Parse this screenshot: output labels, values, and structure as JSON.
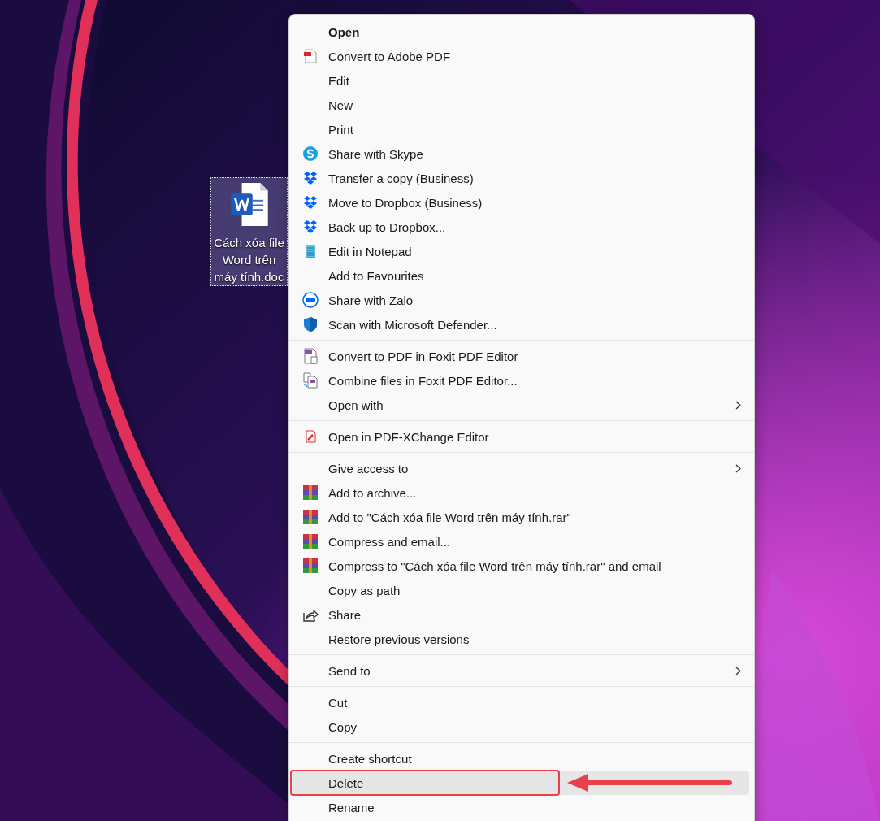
{
  "desktop": {
    "file_icon": {
      "label_lines": [
        "Cách xóa file",
        "Word trên",
        "máy tính.doc"
      ],
      "selected": true
    }
  },
  "context_menu": {
    "groups": [
      [
        {
          "label": "Open",
          "kind": "plain",
          "default": true,
          "submenu": false,
          "highlighted": false,
          "circled": false
        },
        {
          "label": "Convert to Adobe PDF",
          "kind": "pdf",
          "default": false,
          "submenu": false,
          "highlighted": false,
          "circled": false
        },
        {
          "label": "Edit",
          "kind": "plain",
          "default": false,
          "submenu": false,
          "highlighted": false,
          "circled": false
        },
        {
          "label": "New",
          "kind": "plain",
          "default": false,
          "submenu": false,
          "highlighted": false,
          "circled": false
        },
        {
          "label": "Print",
          "kind": "plain",
          "default": false,
          "submenu": false,
          "highlighted": false,
          "circled": false
        },
        {
          "label": "Share with Skype",
          "kind": "skype",
          "default": false,
          "submenu": false,
          "highlighted": false,
          "circled": false
        },
        {
          "label": "Transfer a copy (Business)",
          "kind": "dropbox",
          "default": false,
          "submenu": false,
          "highlighted": false,
          "circled": false
        },
        {
          "label": "Move to Dropbox (Business)",
          "kind": "dropbox",
          "default": false,
          "submenu": false,
          "highlighted": false,
          "circled": false
        },
        {
          "label": "Back up to Dropbox...",
          "kind": "dropbox",
          "default": false,
          "submenu": false,
          "highlighted": false,
          "circled": false
        },
        {
          "label": "Edit in Notepad",
          "kind": "notepad",
          "default": false,
          "submenu": false,
          "highlighted": false,
          "circled": false
        },
        {
          "label": "Add to Favourites",
          "kind": "plain",
          "default": false,
          "submenu": false,
          "highlighted": false,
          "circled": false
        },
        {
          "label": "Share with Zalo",
          "kind": "zalo",
          "default": false,
          "submenu": false,
          "highlighted": false,
          "circled": false
        },
        {
          "label": "Scan with Microsoft Defender...",
          "kind": "defender",
          "default": false,
          "submenu": false,
          "highlighted": false,
          "circled": false
        }
      ],
      [
        {
          "label": "Convert to PDF in Foxit PDF Editor",
          "kind": "foxit",
          "default": false,
          "submenu": false,
          "highlighted": false,
          "circled": false
        },
        {
          "label": "Combine files in Foxit PDF Editor...",
          "kind": "foxit-combine",
          "default": false,
          "submenu": false,
          "highlighted": false,
          "circled": false
        },
        {
          "label": "Open with",
          "kind": "plain",
          "default": false,
          "submenu": true,
          "highlighted": false,
          "circled": false
        }
      ],
      [
        {
          "label": "Open in PDF-XChange Editor",
          "kind": "pdfx",
          "default": false,
          "submenu": false,
          "highlighted": false,
          "circled": false
        }
      ],
      [
        {
          "label": "Give access to",
          "kind": "plain",
          "default": false,
          "submenu": true,
          "highlighted": false,
          "circled": false
        },
        {
          "label": "Add to archive...",
          "kind": "rar",
          "default": false,
          "submenu": false,
          "highlighted": false,
          "circled": false
        },
        {
          "label": "Add to \"Cách xóa file Word trên máy tính.rar\"",
          "kind": "rar",
          "default": false,
          "submenu": false,
          "highlighted": false,
          "circled": false
        },
        {
          "label": "Compress and email...",
          "kind": "rar",
          "default": false,
          "submenu": false,
          "highlighted": false,
          "circled": false
        },
        {
          "label": "Compress to \"Cách xóa file Word trên máy tính.rar\" and email",
          "kind": "rar",
          "default": false,
          "submenu": false,
          "highlighted": false,
          "circled": false
        },
        {
          "label": "Copy as path",
          "kind": "plain",
          "default": false,
          "submenu": false,
          "highlighted": false,
          "circled": false
        },
        {
          "label": "Share",
          "kind": "share",
          "default": false,
          "submenu": false,
          "highlighted": false,
          "circled": false
        },
        {
          "label": "Restore previous versions",
          "kind": "plain",
          "default": false,
          "submenu": false,
          "highlighted": false,
          "circled": false
        }
      ],
      [
        {
          "label": "Send to",
          "kind": "plain",
          "default": false,
          "submenu": true,
          "highlighted": false,
          "circled": false
        }
      ],
      [
        {
          "label": "Cut",
          "kind": "plain",
          "default": false,
          "submenu": false,
          "highlighted": false,
          "circled": false
        },
        {
          "label": "Copy",
          "kind": "plain",
          "default": false,
          "submenu": false,
          "highlighted": false,
          "circled": false
        }
      ],
      [
        {
          "label": "Create shortcut",
          "kind": "plain",
          "default": false,
          "submenu": false,
          "highlighted": false,
          "circled": false
        },
        {
          "label": "Delete",
          "kind": "plain",
          "default": false,
          "submenu": false,
          "highlighted": true,
          "circled": true
        },
        {
          "label": "Rename",
          "kind": "plain",
          "default": false,
          "submenu": false,
          "highlighted": false,
          "circled": false
        }
      ]
    ]
  }
}
